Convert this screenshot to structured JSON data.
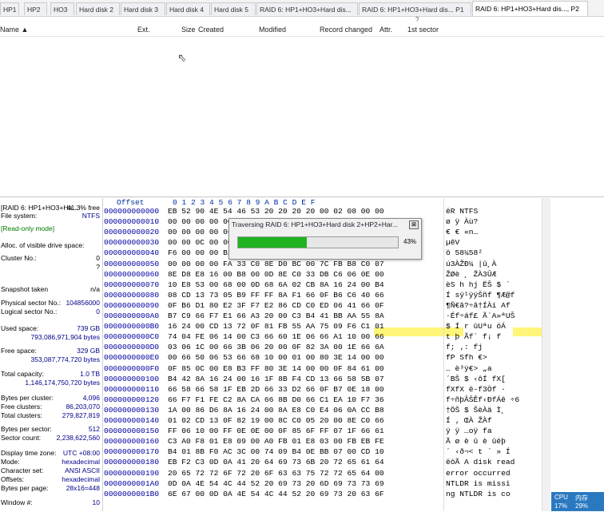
{
  "tabs": [
    {
      "label": "HP1"
    },
    {
      "label": "HP2"
    },
    {
      "label": "HO3"
    },
    {
      "label": "Hard disk 2"
    },
    {
      "label": "Hard disk 3"
    },
    {
      "label": "Hard disk 4"
    },
    {
      "label": "Hard disk 5"
    },
    {
      "label": "RAID 6: HP1+HO3+Hard dis..."
    },
    {
      "label": "RAID 6: HP1+HO3+Hard dis... P1"
    },
    {
      "label": "RAID 6: HP1+HO3+Hard dis..., P2"
    }
  ],
  "tab_tip": "?",
  "list_header": {
    "name": "Name ▲",
    "ext": "Ext.",
    "size": "Size",
    "created": "Created",
    "modified": "Modified",
    "record_changed": "Record changed",
    "attr": "Attr.",
    "first_sector": "1st sector"
  },
  "info": {
    "volume": "[RAID 6: HP1+HO3+Ha...",
    "free_pct": "41.3% free",
    "fs_label": "File system:",
    "fs": "NTFS",
    "mode": "[Read-only mode]",
    "alloc": "Alloc. of visible drive space:",
    "cluster_label": "Cluster No.:",
    "cluster": "0",
    "cluster_q": "?",
    "snapshot_label": "Snapshot taken",
    "snapshot": "n/a",
    "phys_label": "Physical sector No.:",
    "phys": "104856000",
    "logical_label": "Logical sector No.:",
    "logical": "0",
    "used_label": "Used space:",
    "used": "739 GB",
    "used_bytes": "793,086,971,904 bytes",
    "free_label": "Free space:",
    "free": "329 GB",
    "free_bytes": "353,087,774,720 bytes",
    "total_label": "Total capacity:",
    "total": "1.0 TB",
    "total_bytes": "1,146,174,750,720 bytes",
    "bpc_label": "Bytes per cluster:",
    "bpc": "4,096",
    "freec_label": "Free clusters:",
    "freec": "86,203,070",
    "totc_label": "Total clusters:",
    "totc": "279,827,819",
    "bps_label": "Bytes per sector:",
    "bps": "512",
    "sc_label": "Sector count:",
    "sc": "2,238,622,560",
    "tz_label": "Display time zone:",
    "tz": "UTC +08:00",
    "mode_label": "Mode:",
    "mode_v": "hexadecimal",
    "cs_label": "Character set:",
    "cs": "ANSI ASCII",
    "offs_label": "Offsets:",
    "offs": "hexadecimal",
    "bpp_label": "Bytes per page:",
    "bpp": "28x16=448",
    "win_label": "Window #:",
    "win": "10"
  },
  "hex_header": {
    "offset": "Offset",
    "cols": "0  1  2  3  4  5  6  7   8  9  A  B  C  D  E  F"
  },
  "hex_rows": [
    {
      "off": "000000000000",
      "b": "EB 52 90 4E 54 46 53 20  20 20 20 00 02 08 00 00",
      "t": "ëR NTFS"
    },
    {
      "off": "000000000010",
      "b": "00 00 00 00 00                               06",
      "t": "    ø     ÿ Àù?"
    },
    {
      "off": "000000000020",
      "b": "00 00 00 00                                  06",
      "t": "  € €  «n…"
    },
    {
      "off": "000000000030",
      "b": "00 00 0C 00                                  00",
      "t": "       µêV"
    },
    {
      "off": "000000000040",
      "b": "F6 00 00 00                                  B2",
      "t": "ö         58¼58²"
    },
    {
      "off": "000000000050",
      "b": "00 00 00 00 FA 33 C0 8E  D0 BC 00 7C FB B8 C0 07",
      "t": "    ú3ÀŽÐ¼ |û¸À"
    },
    {
      "off": "000000000060",
      "b": "8E D8 E8 16 00 B8 00 0D  8E C0 33 DB C6 06 0E 00",
      "t": "ŽØè  ¸  ŽÀ3ÛÆ"
    },
    {
      "off": "000000000070",
      "b": "10 E8 53 00 68 00 0D 68  6A 02 CB 8A 16 24 00 B4",
      "t": " èS h  hj ËŠ $ ´"
    },
    {
      "off": "000000000080",
      "b": "08 CD 13 73 05 B9 FF FF  8A F1 66 0F B6 C6 40 66",
      "t": " Í sÿ¹ÿÿŠñf ¶Æ@f"
    },
    {
      "off": "000000000090",
      "b": "0F B6 D1 80 E2 3F F7 E2  86 CD C0 ED 06 41 66 0F",
      "t": " ¶Ñ€â?÷â†ÍÀí Af"
    },
    {
      "off": "0000000000A0",
      "b": "B7 C9 66 F7 E1 66 A3 20  00 C3 B4 41 BB AA 55 8A",
      "t": "·Éf÷áf£  Ã´A»ªUŠ"
    },
    {
      "off": "0000000000B0",
      "b": "16 24 00 CD 13 72 0F 81  FB 55 AA 75 09 F6 C1 01",
      "t": " $ Í r  ûUªu öÁ"
    },
    {
      "off": "0000000000C0",
      "b": "74 04 FE 06 14 00 C3 66  60 1E 06 66 A1 10 00 66",
      "t": "t þ   Ãf` f¡  f"
    },
    {
      "off": "0000000000D0",
      "b": "03 06 1C 00 66 3B 06 20  00 0F 82 3A 00 1E 66 6A",
      "t": "    f;    ‚:  fj"
    },
    {
      "off": "0000000000E0",
      "b": "00 66 50 06 53 66 68 10  00 01 00 80 3E 14 00 00",
      "t": " fP Sfh    €>"
    },
    {
      "off": "0000000000F0",
      "b": "0F 85 0C 00 E8 B3 FF 80  3E 14 00 00 0F 84 61 00",
      "t": " …  è³ÿ€>    „a"
    },
    {
      "off": "000000000100",
      "b": "B4 42 8A 16 24 00 16 1F  8B F4 CD 13 66 58 5B 07",
      "t": "´BŠ $   ‹ôÍ fX["
    },
    {
      "off": "000000000110",
      "b": "66 58 66 58 1F EB 2D 66  33 D2 66 0F B7 0E 18 00",
      "t": "fXfX ë-f3Òf ·"
    },
    {
      "off": "000000000120",
      "b": "66 F7 F1 FE C2 8A CA 66  8B D0 66 C1 EA 10 F7 36",
      "t": "f÷ñþÂŠÊf‹ÐfÁê ÷6"
    },
    {
      "off": "000000000130",
      "b": "1A 00 86 D6 8A 16 24 00  8A E8 C0 E4 06 0A CC B8",
      "t": "  †ÖŠ $ ŠèÀä Ì¸"
    },
    {
      "off": "000000000140",
      "b": "01 02 CD 13 0F 82 19 00  8C C0 05 20 00 8E C0 66",
      "t": "  Í  ‚  ŒÀ   ŽÀf"
    },
    {
      "off": "000000000150",
      "b": "FF 06 10 00 FF 0E 0E 00  0F 85 6F FF 07 1F 66 61",
      "t": "ÿ   ÿ    …oÿ  fa"
    },
    {
      "off": "000000000160",
      "b": "C3 A0 F8 01 E8 09 00 A0  FB 01 E8 03 00 FB EB FE",
      "t": "Ã ø è   û è  ûëþ"
    },
    {
      "off": "000000000170",
      "b": "B4 01 8B F0 AC 3C 00 74  09 B4 0E BB 07 00 CD 10",
      "t": "´ ‹ð¬< t ´ »  Í"
    },
    {
      "off": "000000000180",
      "b": "EB F2 C3 0D 0A 41 20 64  69 73 6B 20 72 65 61 64",
      "t": "ëòÃ  A disk read"
    },
    {
      "off": "000000000190",
      "b": "20 65 72 72 6F 72 20 6F  63 63 75 72 72 65 64 00",
      "t": " error occurred"
    },
    {
      "off": "0000000001A0",
      "b": "0D 0A 4E 54 4C 44 52 20  69 73 20 6D 69 73 73 69",
      "t": "  NTLDR is missi"
    },
    {
      "off": "0000000001B0",
      "b": "6E 67 00 0D 0A 4E 54 4C  44 52 20 69 73 20 63 6F",
      "t": "ng  NTLDR is co"
    }
  ],
  "dialog": {
    "title": "Traversing RAID 6: HP1+HO3+Hard disk 2+HP2+Har...",
    "close": "⊠",
    "progress": 0.43,
    "progress_text": "43%"
  },
  "tray": {
    "cpu": "CPU",
    "cpu_val": "17%",
    "mem": "内存",
    "mem_val": "29%"
  },
  "colors": {
    "progress": "#1fb41f",
    "selection": "#fff578",
    "offset": "#0000a0"
  }
}
